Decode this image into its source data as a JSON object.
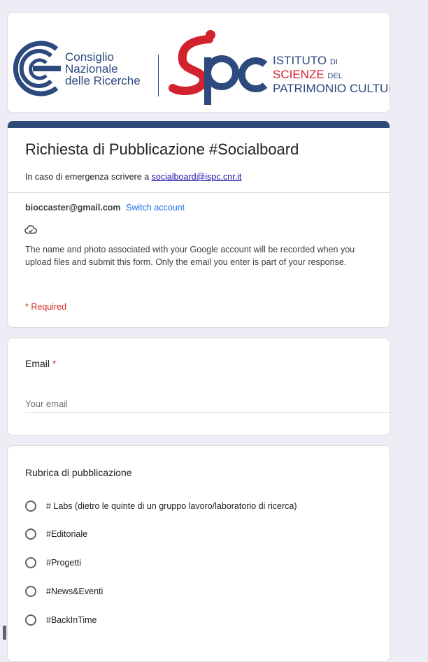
{
  "banner": {
    "cnr_lines": [
      "Consiglio",
      "Nazionale",
      "delle Ricerche"
    ],
    "ispc_line1": "ISTITUTO",
    "ispc_line1_small": "DI",
    "ispc_line2": "SCIENZE",
    "ispc_line2_small": "DEL",
    "ispc_line3": "PATRIMONIO CULTURALE",
    "logo_word": "spc"
  },
  "form": {
    "title": "Richiesta di Pubblicazione #Socialboard",
    "desc_prefix": "In caso di emergenza scrivere a ",
    "desc_email": "socialboard@ispc.cnr.it",
    "account_email": "bioccaster@gmail.com",
    "switch_account": "Switch account",
    "privacy_text": "The name and photo associated with your Google account will be recorded when you upload files and submit this form. Only the email you enter is part of your response.",
    "required_note": "* Required"
  },
  "email_question": {
    "label": "Email",
    "required_star": "*",
    "placeholder": "Your email"
  },
  "rubrica": {
    "label": "Rubrica di pubblicazione",
    "options": [
      "# Labs (dietro le quinte di un gruppo lavoro/laboratorio di ricerca)",
      "#Editoriale",
      "#Progetti",
      "#News&Eventi",
      "#BackInTime"
    ]
  },
  "colors": {
    "accent": "#2e4a78",
    "link": "#1a73e8",
    "required": "#d93025",
    "logo_red": "#d2222d",
    "logo_blue": "#2c4a7e"
  }
}
